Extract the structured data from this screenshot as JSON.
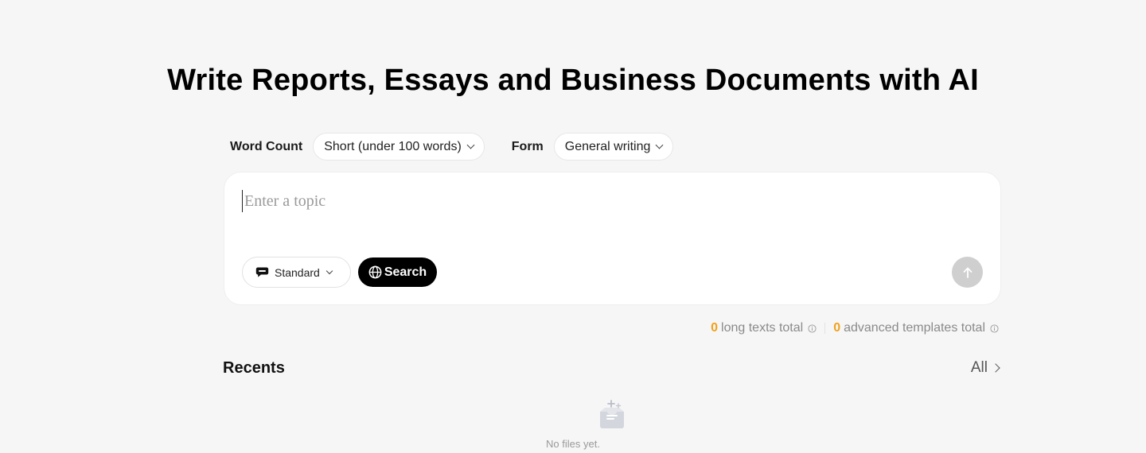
{
  "header": {
    "title": "Write Reports, Essays and Business Documents with AI"
  },
  "options": {
    "word_count_label": "Word Count",
    "word_count_value": "Short (under 100 words)",
    "form_label": "Form",
    "form_value": "General writing"
  },
  "editor": {
    "placeholder": "Enter a topic",
    "mode_label": "Standard",
    "search_label": "Search"
  },
  "quota": {
    "long_texts_count": "0",
    "long_texts_label": "long texts total",
    "templates_count": "0",
    "templates_label": "advanced templates total"
  },
  "recents": {
    "title": "Recents",
    "all_label": "All",
    "empty_text": "No files yet."
  },
  "colors": {
    "page_bg": "#f6f6f6",
    "accent_count": "#f0a11a",
    "send_disabled": "#cfcfcf"
  },
  "icons": {
    "mode": "chat-bubble-icon",
    "search": "globe-icon",
    "send": "arrow-up-icon",
    "info": "info-icon",
    "empty": "empty-inbox-icon"
  }
}
